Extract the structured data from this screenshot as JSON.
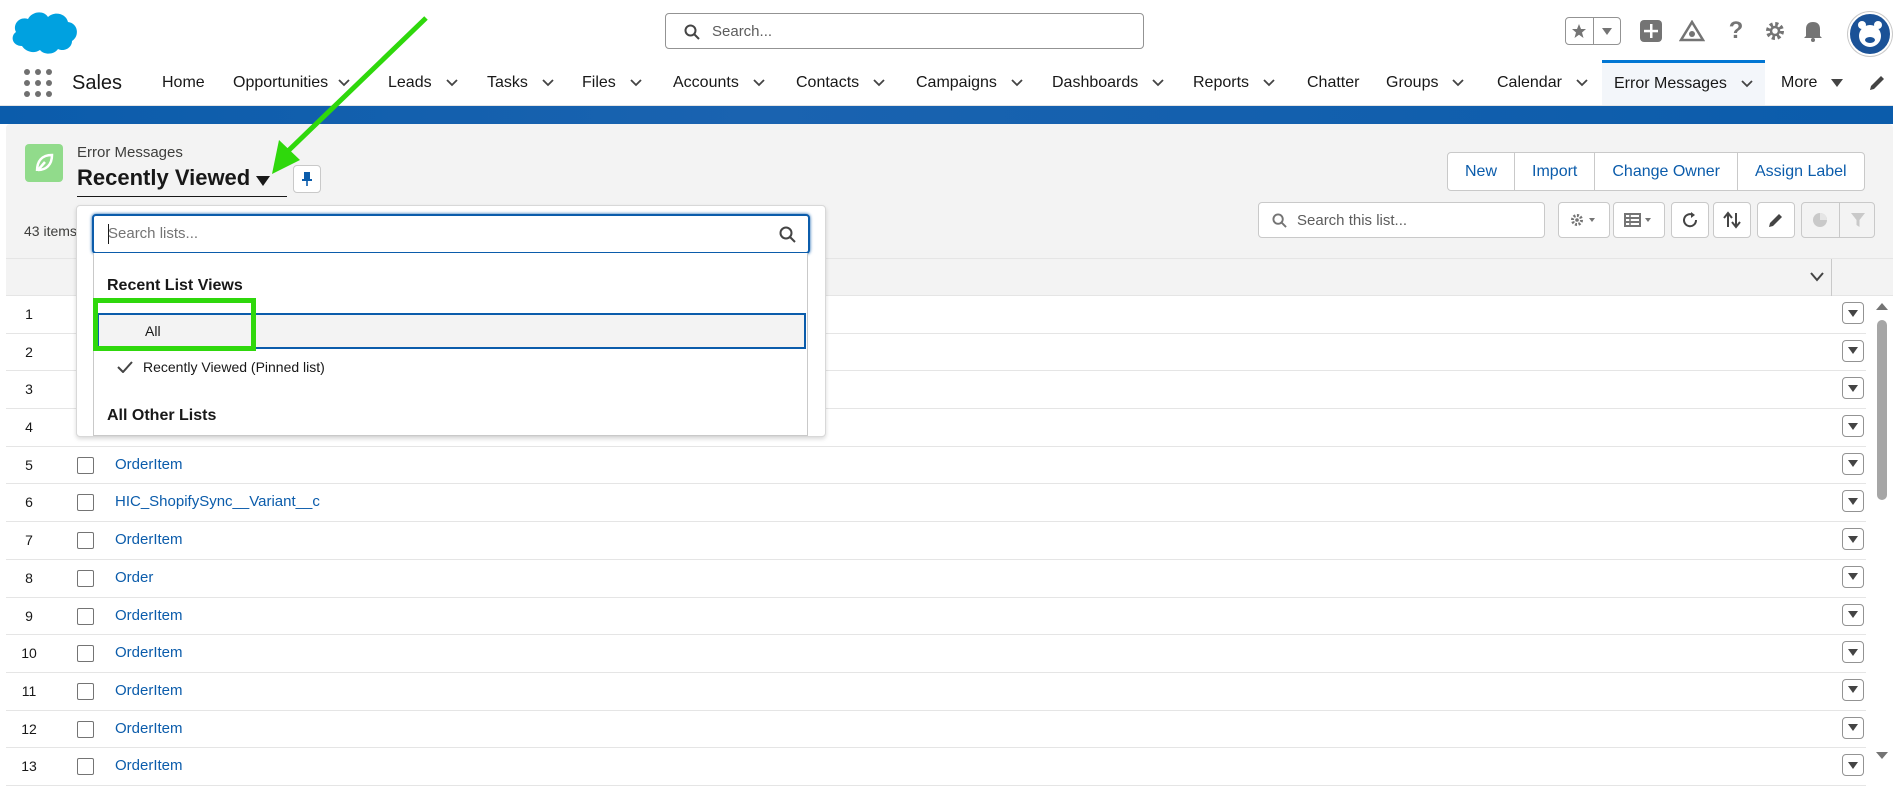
{
  "header": {
    "search_placeholder": "Search...",
    "icons": [
      "salesforce-cloud-logo",
      "search-icon",
      "star-icon",
      "chevron-down-icon",
      "add-icon",
      "trailhead-icon",
      "help-icon",
      "gear-icon",
      "bell-icon",
      "avatar"
    ]
  },
  "nav": {
    "app_name": "Sales",
    "items": [
      {
        "label": "Home",
        "dropdown": false
      },
      {
        "label": "Opportunities",
        "dropdown": true
      },
      {
        "label": "Leads",
        "dropdown": true
      },
      {
        "label": "Tasks",
        "dropdown": true
      },
      {
        "label": "Files",
        "dropdown": true
      },
      {
        "label": "Accounts",
        "dropdown": true
      },
      {
        "label": "Contacts",
        "dropdown": true
      },
      {
        "label": "Campaigns",
        "dropdown": true
      },
      {
        "label": "Dashboards",
        "dropdown": true
      },
      {
        "label": "Reports",
        "dropdown": true
      },
      {
        "label": "Chatter",
        "dropdown": false
      },
      {
        "label": "Groups",
        "dropdown": true
      },
      {
        "label": "Calendar",
        "dropdown": true
      },
      {
        "label": "Error Messages",
        "dropdown": true,
        "active": true
      },
      {
        "label": "More",
        "dropdown": true
      }
    ]
  },
  "list_header": {
    "object_label": "Error Messages",
    "list_title": "Recently Viewed",
    "items_count": "43 items",
    "buttons": [
      "New",
      "Import",
      "Change Owner",
      "Assign Label"
    ],
    "search_placeholder": "Search this list..."
  },
  "dropdown": {
    "search_placeholder": "Search lists...",
    "recent_heading": "Recent List Views",
    "recent_items": [
      {
        "label": "All",
        "checked": false,
        "highlighted": true
      },
      {
        "label": "Recently Viewed (Pinned list)",
        "checked": true,
        "highlighted": false
      }
    ],
    "other_heading": "All Other Lists"
  },
  "rows": [
    {
      "num": "1",
      "name": ""
    },
    {
      "num": "2",
      "name": ""
    },
    {
      "num": "3",
      "name": ""
    },
    {
      "num": "4",
      "name": ""
    },
    {
      "num": "5",
      "name": "OrderItem"
    },
    {
      "num": "6",
      "name": "HIC_ShopifySync__Variant__c"
    },
    {
      "num": "7",
      "name": "OrderItem"
    },
    {
      "num": "8",
      "name": "Order"
    },
    {
      "num": "9",
      "name": "OrderItem"
    },
    {
      "num": "10",
      "name": "OrderItem"
    },
    {
      "num": "11",
      "name": "OrderItem"
    },
    {
      "num": "12",
      "name": "OrderItem"
    },
    {
      "num": "13",
      "name": "OrderItem"
    }
  ],
  "colors": {
    "brand_blue": "#0b5cab",
    "annotation_green": "#2fd80c",
    "object_icon_green": "#91db8b"
  }
}
